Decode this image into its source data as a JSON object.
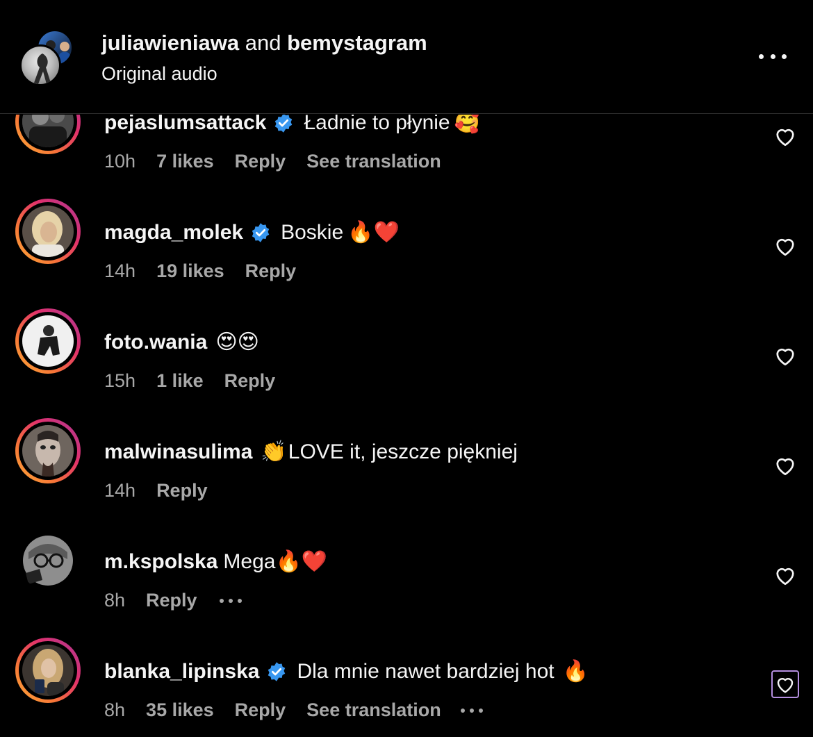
{
  "header": {
    "user1": "juliawieniawa",
    "joiner": "and",
    "user2": "bemystagram",
    "subtitle": "Original audio"
  },
  "comments": [
    {
      "username": "pejaslumsattack",
      "verified": true,
      "text": "Ładnie to płynie",
      "emoji": "🥰",
      "time": "10h",
      "likes": "7 likes",
      "reply": "Reply",
      "translate": "See translation",
      "ring": true,
      "avatar_color": "#3a3a3a"
    },
    {
      "username": "magda_molek",
      "verified": true,
      "text": "Boskie",
      "emoji": "🔥❤️",
      "time": "14h",
      "likes": "19 likes",
      "reply": "Reply",
      "ring": true,
      "avatar_color": "#c9b89a"
    },
    {
      "username": "foto.wania",
      "verified": false,
      "text": "",
      "emoji": "😍😍",
      "time": "15h",
      "likes": "1 like",
      "reply": "Reply",
      "ring": true,
      "avatar_color": "#e8e8e8"
    },
    {
      "username": "malwinasulima",
      "verified": false,
      "text": "LOVE it, jeszcze piękniej",
      "emoji_before": "👏",
      "time": "14h",
      "reply": "Reply",
      "ring": true,
      "avatar_color": "#7a6e66"
    },
    {
      "username": "m.kspolska",
      "verified": false,
      "text": "Mega",
      "emoji": "🔥❤️",
      "time": "8h",
      "reply": "Reply",
      "ring": false,
      "avatar_color": "#9a9a9a"
    },
    {
      "username": "blanka_lipinska",
      "verified": true,
      "text": "Dla mnie nawet bardziej hot",
      "emoji": "🔥",
      "time": "8h",
      "likes": "35 likes",
      "reply": "Reply",
      "translate": "See translation",
      "ring": true,
      "avatar_color": "#b8a07a"
    }
  ],
  "colors": {
    "background": "#000000",
    "text": "#f5f5f5",
    "meta_text": "#a8a8a8",
    "verified_blue": "#3897f0",
    "focus_outline": "#b58fe0"
  },
  "icons": [
    "more-icon",
    "verified-icon",
    "heart-outline-icon"
  ]
}
